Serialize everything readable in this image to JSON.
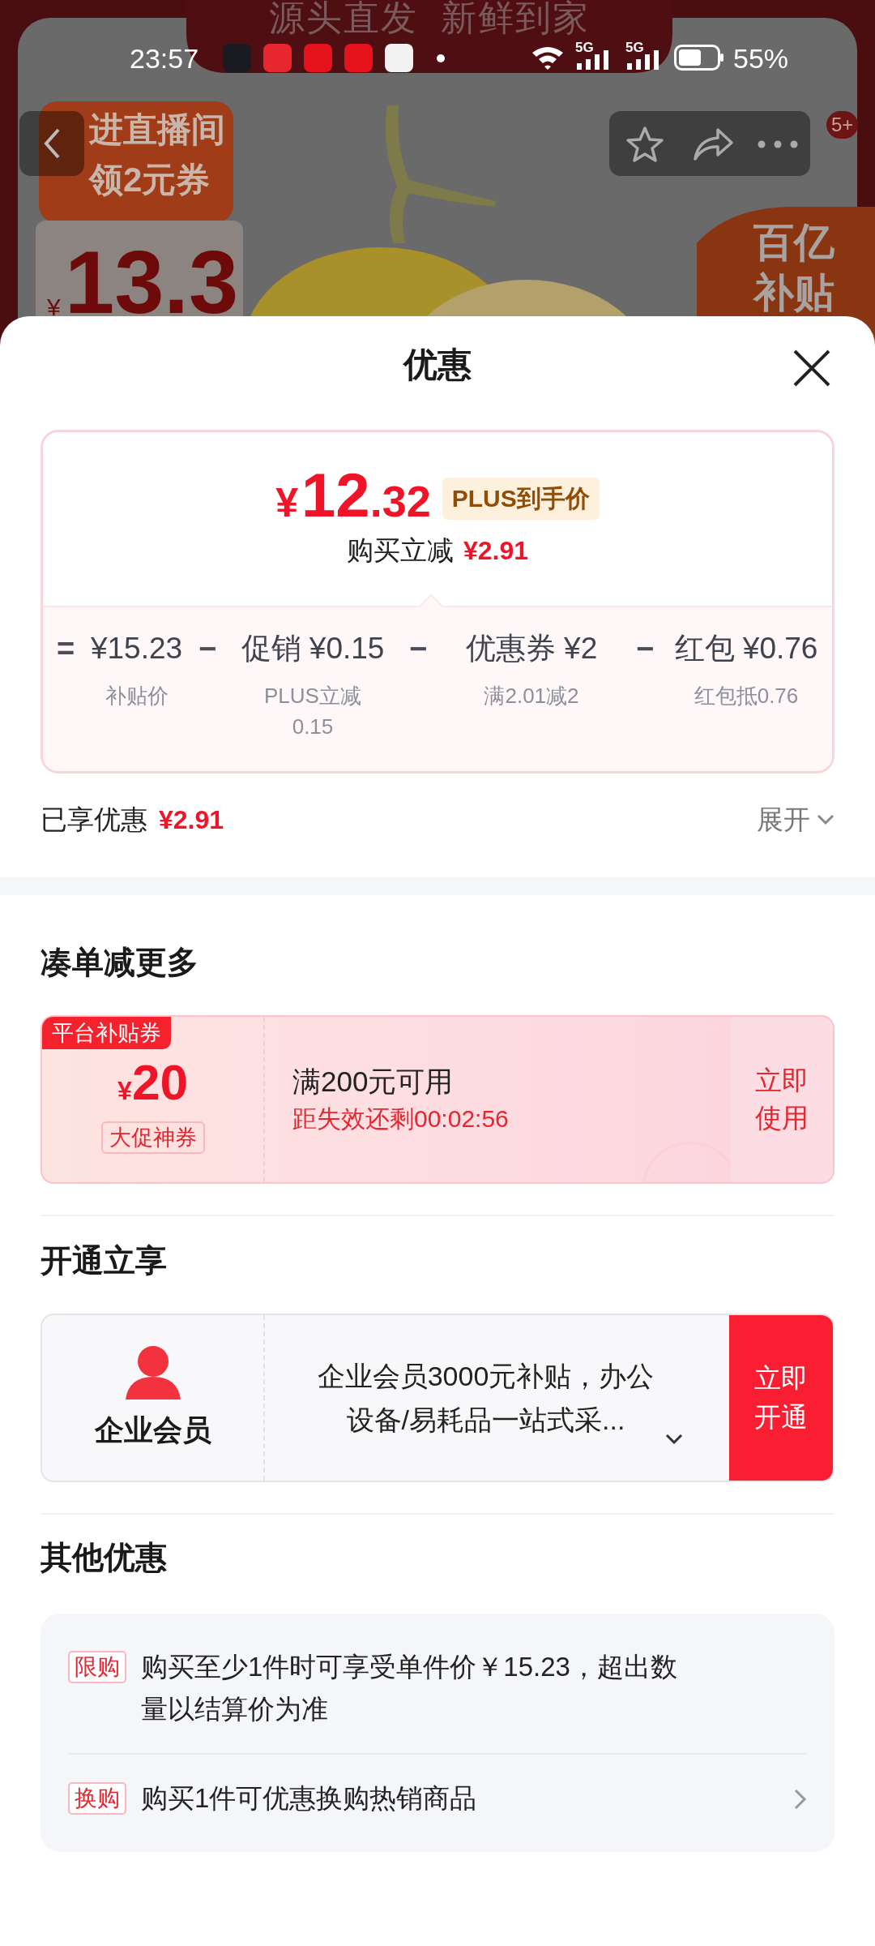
{
  "status_bar": {
    "time": "23:57",
    "network_labels": [
      "5G",
      "5G"
    ],
    "battery": "55%"
  },
  "product_backdrop": {
    "kind": "picture",
    "headline": "源头直发  新鲜到家",
    "promo_lines": [
      "进直播间",
      "领2元券"
    ],
    "price_symbol": "¥",
    "price": "13.3",
    "subsidy_lines": [
      "百亿",
      "补贴"
    ],
    "notification_count": "5+"
  },
  "sheet": {
    "title": "优惠"
  },
  "price_summary": {
    "currency": "¥",
    "price_integer": "12",
    "price_decimal": ".32",
    "price_tag": "PLUS到手价",
    "saving_label": "购买立减",
    "saving_amount": "¥2.91"
  },
  "breakdown": [
    {
      "operator": "=",
      "amount": "¥15.23",
      "note": "补贴价"
    },
    {
      "operator": "−",
      "amount": "促销 ¥0.15",
      "note": "PLUS立减0.15"
    },
    {
      "operator": "−",
      "amount": "优惠券 ¥2",
      "note": "满2.01减2"
    },
    {
      "operator": "−",
      "amount": "红包 ¥0.76",
      "note": "红包抵0.76"
    }
  ],
  "enjoyed": {
    "label": "已享优惠",
    "amount": "¥2.91",
    "toggle": "展开"
  },
  "more_section": {
    "heading": "凑单减更多",
    "coupon": {
      "tag": "平台补贴券",
      "currency": "¥",
      "amount": "20",
      "type": "大促神券",
      "condition": "满200元可用",
      "countdown": "距失效还剩00:02:56",
      "action": "立即使用"
    }
  },
  "membership_section": {
    "heading": "开通立享",
    "title": "企业会员",
    "description": "企业会员3000元补贴，办公设备/易耗品一站式采...",
    "action": "立即开通"
  },
  "other_section": {
    "heading": "其他优惠",
    "items": [
      {
        "tag": "限购",
        "text": "购买至少1件时可享受单件价￥15.23，超出数量以结算价为准",
        "has_arrow": false
      },
      {
        "tag": "换购",
        "text": "购买1件可优惠换购热销商品",
        "has_arrow": true
      }
    ]
  }
}
